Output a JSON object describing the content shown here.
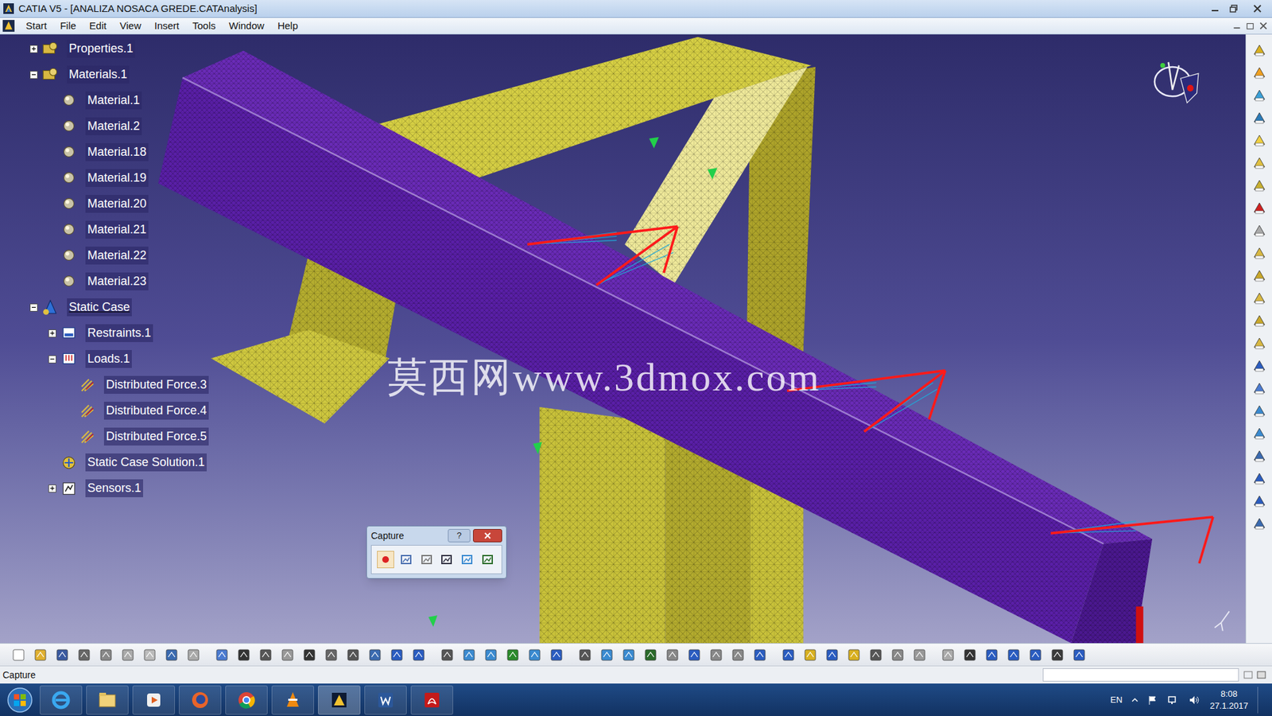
{
  "window": {
    "title": "CATIA V5 - [ANALIZA NOSACA GREDE.CATAnalysis]"
  },
  "menu": [
    {
      "label": "Start"
    },
    {
      "label": "File"
    },
    {
      "label": "Edit"
    },
    {
      "label": "View"
    },
    {
      "label": "Insert"
    },
    {
      "label": "Tools"
    },
    {
      "label": "Window"
    },
    {
      "label": "Help"
    }
  ],
  "tree": [
    {
      "label": "Properties.1",
      "level": 0,
      "kind": "properties",
      "has_children": true,
      "expanded": false,
      "underlined": false
    },
    {
      "label": "Materials.1",
      "level": 0,
      "kind": "materials",
      "has_children": true,
      "expanded": true,
      "underlined": false
    },
    {
      "label": "Material.1",
      "level": 1,
      "kind": "material",
      "has_children": false,
      "expanded": false,
      "underlined": false
    },
    {
      "label": "Material.2",
      "level": 1,
      "kind": "material",
      "has_children": false,
      "expanded": false,
      "underlined": false
    },
    {
      "label": "Material.18",
      "level": 1,
      "kind": "material",
      "has_children": false,
      "expanded": false,
      "underlined": false
    },
    {
      "label": "Material.19",
      "level": 1,
      "kind": "material",
      "has_children": false,
      "expanded": false,
      "underlined": false
    },
    {
      "label": "Material.20",
      "level": 1,
      "kind": "material",
      "has_children": false,
      "expanded": false,
      "underlined": false
    },
    {
      "label": "Material.21",
      "level": 1,
      "kind": "material",
      "has_children": false,
      "expanded": false,
      "underlined": false
    },
    {
      "label": "Material.22",
      "level": 1,
      "kind": "material",
      "has_children": false,
      "expanded": false,
      "underlined": false
    },
    {
      "label": "Material.23",
      "level": 1,
      "kind": "material",
      "has_children": false,
      "expanded": false,
      "underlined": false
    },
    {
      "label": "Static Case",
      "level": 0,
      "kind": "case",
      "has_children": true,
      "expanded": true,
      "underlined": true
    },
    {
      "label": "Restraints.1",
      "level": 1,
      "kind": "restraints",
      "has_children": true,
      "expanded": false,
      "underlined": false
    },
    {
      "label": "Loads.1",
      "level": 1,
      "kind": "loads",
      "has_children": true,
      "expanded": true,
      "underlined": false
    },
    {
      "label": "Distributed Force.3",
      "level": 2,
      "kind": "force",
      "has_children": false,
      "expanded": false,
      "underlined": false
    },
    {
      "label": "Distributed Force.4",
      "level": 2,
      "kind": "force",
      "has_children": false,
      "expanded": false,
      "underlined": false
    },
    {
      "label": "Distributed Force.5",
      "level": 2,
      "kind": "force",
      "has_children": false,
      "expanded": false,
      "underlined": false
    },
    {
      "label": "Static Case Solution.1",
      "level": 1,
      "kind": "solution",
      "has_children": false,
      "expanded": false,
      "underlined": false
    },
    {
      "label": "Sensors.1",
      "level": 1,
      "kind": "sensors",
      "has_children": true,
      "expanded": false,
      "underlined": false
    }
  ],
  "watermark": "莫西网www.3dmox.com",
  "capture": {
    "title": "Capture",
    "help": "?"
  },
  "status_bar": "Capture",
  "taskbar": {
    "language": "EN",
    "time": "8:08",
    "date": "27.1.2017"
  }
}
